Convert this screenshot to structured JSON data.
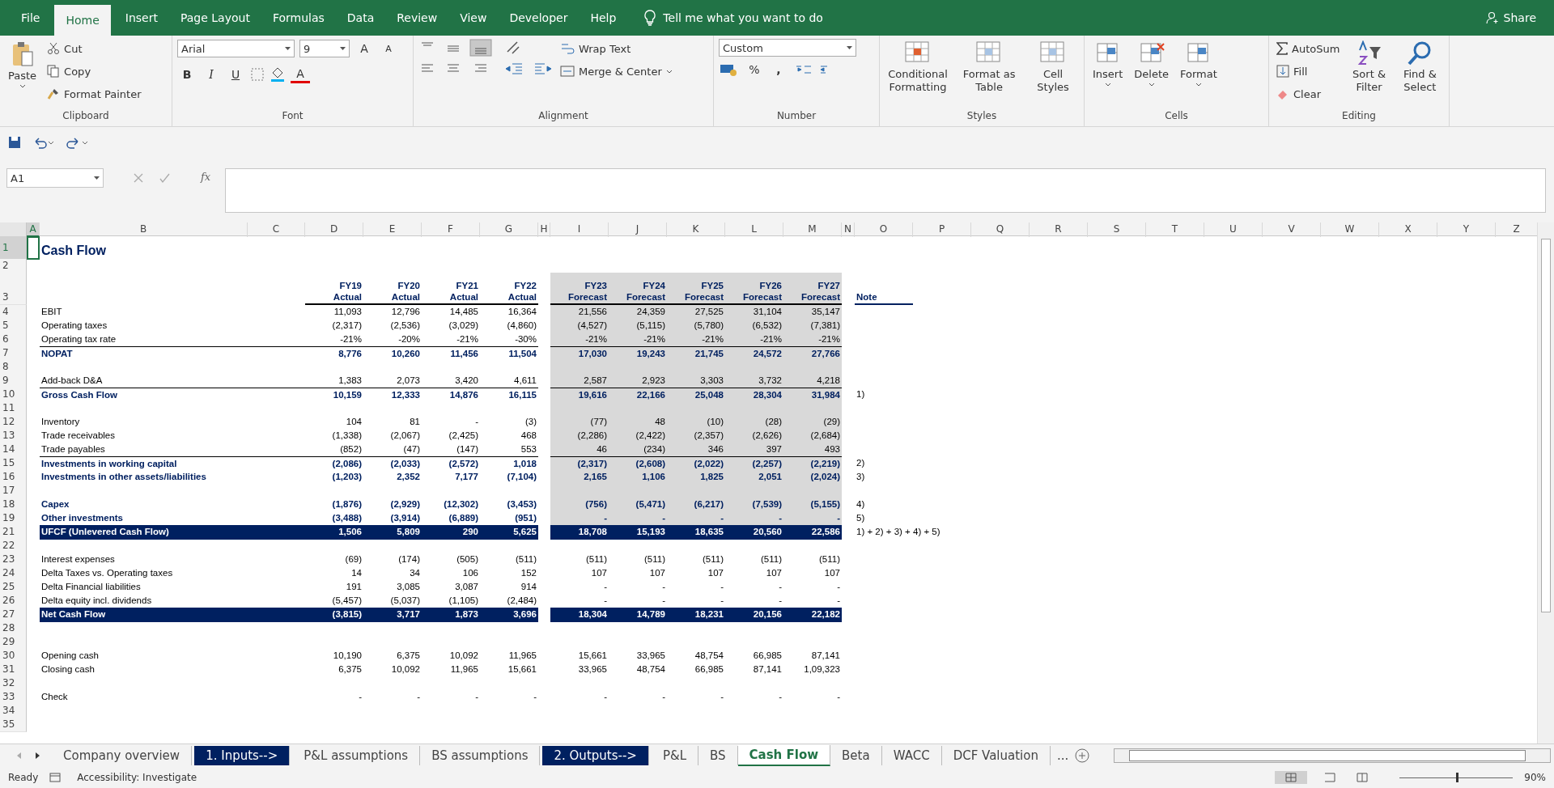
{
  "menu": {
    "tabs": [
      {
        "label": "File",
        "selected": false
      },
      {
        "label": "Home",
        "selected": true
      },
      {
        "label": "Insert",
        "selected": false
      },
      {
        "label": "Page Layout",
        "selected": false
      },
      {
        "label": "Formulas",
        "selected": false
      },
      {
        "label": "Data",
        "selected": false
      },
      {
        "label": "Review",
        "selected": false
      },
      {
        "label": "View",
        "selected": false
      },
      {
        "label": "Developer",
        "selected": false
      },
      {
        "label": "Help",
        "selected": false
      }
    ],
    "tell_me": "Tell me what you want to do",
    "share": "Share"
  },
  "ribbon": {
    "clipboard": {
      "paste": "Paste",
      "cut": "Cut",
      "copy": "Copy",
      "format_painter": "Format Painter",
      "label": "Clipboard"
    },
    "font": {
      "name": "Arial",
      "size": "9",
      "grow": "A",
      "shrink": "A",
      "bold": "B",
      "italic": "I",
      "underline": "U",
      "font_color": "A",
      "label": "Font"
    },
    "alignment": {
      "wrap": "Wrap Text",
      "merge": "Merge & Center",
      "label": "Alignment"
    },
    "number": {
      "format": "Custom",
      "percent": "%",
      "comma": ",",
      "label": "Number"
    },
    "styles": {
      "buttons": [
        "Conditional Formatting",
        "Format as Table",
        "Cell Styles"
      ],
      "label": "Styles"
    },
    "cells": {
      "buttons": [
        "Insert",
        "Delete",
        "Format"
      ],
      "label": "Cells"
    },
    "editing": {
      "autosum": "AutoSum",
      "fill": "Fill",
      "clear": "Clear",
      "sort": "Sort & Filter",
      "find": "Find & Select",
      "label": "Editing"
    }
  },
  "formula_bar": {
    "name_box": "A1",
    "fx": "fx"
  },
  "columns": [
    "A",
    "B",
    "C",
    "D",
    "E",
    "F",
    "G",
    "H",
    "I",
    "J",
    "K",
    "L",
    "M",
    "N",
    "O",
    "P",
    "Q",
    "R",
    "S",
    "T",
    "U",
    "V",
    "W",
    "X",
    "Y",
    "Z"
  ],
  "rows": [
    {
      "row": "1",
      "kind": "title",
      "label": "Cash Flow",
      "shaded": false
    },
    {
      "row": "2",
      "kind": "blank",
      "shaded": false
    },
    {
      "row": "3",
      "kind": "header",
      "shaded": true,
      "headers": [
        {
          "year": "FY19",
          "period": "Actual"
        },
        {
          "year": "FY20",
          "period": "Actual"
        },
        {
          "year": "FY21",
          "period": "Actual"
        },
        {
          "year": "FY22",
          "period": "Actual"
        },
        {
          "year": "FY23",
          "period": "Forecast"
        },
        {
          "year": "FY24",
          "period": "Forecast"
        },
        {
          "year": "FY25",
          "period": "Forecast"
        },
        {
          "year": "FY26",
          "period": "Forecast"
        },
        {
          "year": "FY27",
          "period": "Forecast"
        }
      ],
      "note": "Note"
    },
    {
      "row": "4",
      "kind": "line",
      "label": "EBIT",
      "shaded": true,
      "values": [
        "11,093",
        "12,796",
        "14,485",
        "16,364",
        "21,556",
        "24,359",
        "27,525",
        "31,104",
        "35,147"
      ]
    },
    {
      "row": "5",
      "kind": "line",
      "label": "Operating taxes",
      "shaded": true,
      "values": [
        "(2,317)",
        "(2,536)",
        "(3,029)",
        "(4,860)",
        "(4,527)",
        "(5,115)",
        "(5,780)",
        "(6,532)",
        "(7,381)"
      ]
    },
    {
      "row": "6",
      "kind": "line",
      "label": "Operating tax rate",
      "shaded": true,
      "values": [
        "-21%",
        "-20%",
        "-21%",
        "-30%",
        "-21%",
        "-21%",
        "-21%",
        "-21%",
        "-21%"
      ]
    },
    {
      "row": "7",
      "kind": "subtotal",
      "label": "NOPAT",
      "shaded": true,
      "values": [
        "8,776",
        "10,260",
        "11,456",
        "11,504",
        "17,030",
        "19,243",
        "21,745",
        "24,572",
        "27,766"
      ]
    },
    {
      "row": "8",
      "kind": "blank",
      "shaded": true
    },
    {
      "row": "9",
      "kind": "line",
      "label": "Add-back D&A",
      "shaded": true,
      "values": [
        "1,383",
        "2,073",
        "3,420",
        "4,611",
        "2,587",
        "2,923",
        "3,303",
        "3,732",
        "4,218"
      ]
    },
    {
      "row": "10",
      "kind": "subtotal",
      "label": "Gross Cash Flow",
      "shaded": true,
      "values": [
        "10,159",
        "12,333",
        "14,876",
        "16,115",
        "19,616",
        "22,166",
        "25,048",
        "28,304",
        "31,984"
      ],
      "note": "1)"
    },
    {
      "row": "11",
      "kind": "blank",
      "shaded": true
    },
    {
      "row": "12",
      "kind": "line",
      "label": "Inventory",
      "shaded": true,
      "values": [
        "104",
        "81",
        "-",
        "(3)",
        "(77)",
        "48",
        "(10)",
        "(28)",
        "(29)"
      ]
    },
    {
      "row": "13",
      "kind": "line",
      "label": "Trade receivables",
      "shaded": true,
      "values": [
        "(1,338)",
        "(2,067)",
        "(2,425)",
        "468",
        "(2,286)",
        "(2,422)",
        "(2,357)",
        "(2,626)",
        "(2,684)"
      ]
    },
    {
      "row": "14",
      "kind": "line",
      "label": "Trade payables",
      "shaded": true,
      "values": [
        "(852)",
        "(47)",
        "(147)",
        "553",
        "46",
        "(234)",
        "346",
        "397",
        "493"
      ]
    },
    {
      "row": "15",
      "kind": "subtotal",
      "label": "Investments in working capital",
      "shaded": true,
      "values": [
        "(2,086)",
        "(2,033)",
        "(2,572)",
        "1,018",
        "(2,317)",
        "(2,608)",
        "(2,022)",
        "(2,257)",
        "(2,219)"
      ],
      "note": "2)"
    },
    {
      "row": "16",
      "kind": "bold",
      "label": "Investments in other assets/liabilities",
      "shaded": true,
      "values": [
        "(1,203)",
        "2,352",
        "7,177",
        "(7,104)",
        "2,165",
        "1,106",
        "1,825",
        "2,051",
        "(2,024)"
      ],
      "note": "3)"
    },
    {
      "row": "17",
      "kind": "blank",
      "shaded": true
    },
    {
      "row": "18",
      "kind": "bold",
      "label": "Capex",
      "shaded": true,
      "values": [
        "(1,876)",
        "(2,929)",
        "(12,302)",
        "(3,453)",
        "(756)",
        "(5,471)",
        "(6,217)",
        "(7,539)",
        "(5,155)"
      ],
      "note": "4)"
    },
    {
      "row": "19",
      "kind": "bold",
      "label": "Other investments",
      "shaded": true,
      "values": [
        "(3,488)",
        "(3,914)",
        "(6,889)",
        "(951)",
        "-",
        "-",
        "-",
        "-",
        "-"
      ],
      "note": "5)"
    },
    {
      "row": "21",
      "kind": "total",
      "label": "UFCF (Unlevered Cash Flow)",
      "shaded": false,
      "values": [
        "1,506",
        "5,809",
        "290",
        "5,625",
        "18,708",
        "15,193",
        "18,635",
        "20,560",
        "22,586"
      ],
      "note": "1) + 2) + 3) + 4) + 5)"
    },
    {
      "row": "22",
      "kind": "blank",
      "shaded": false
    },
    {
      "row": "23",
      "kind": "line",
      "label": "Interest expenses",
      "shaded": false,
      "values": [
        "(69)",
        "(174)",
        "(505)",
        "(511)",
        "(511)",
        "(511)",
        "(511)",
        "(511)",
        "(511)"
      ]
    },
    {
      "row": "24",
      "kind": "line",
      "label": "Delta Taxes vs. Operating taxes",
      "shaded": false,
      "values": [
        "14",
        "34",
        "106",
        "152",
        "107",
        "107",
        "107",
        "107",
        "107"
      ]
    },
    {
      "row": "25",
      "kind": "line",
      "label": "Delta Financial liabilities",
      "shaded": false,
      "values": [
        "191",
        "3,085",
        "3,087",
        "914",
        "-",
        "-",
        "-",
        "-",
        "-"
      ]
    },
    {
      "row": "26",
      "kind": "line",
      "label": "Delta equity incl. dividends",
      "shaded": false,
      "values": [
        "(5,457)",
        "(5,037)",
        "(1,105)",
        "(2,484)",
        "-",
        "-",
        "-",
        "-",
        "-"
      ]
    },
    {
      "row": "27",
      "kind": "total",
      "label": "Net Cash Flow",
      "shaded": false,
      "values": [
        "(3,815)",
        "3,717",
        "1,873",
        "3,696",
        "18,304",
        "14,789",
        "18,231",
        "20,156",
        "22,182"
      ]
    },
    {
      "row": "28",
      "kind": "blank",
      "shaded": false
    },
    {
      "row": "29",
      "kind": "blank",
      "shaded": false
    },
    {
      "row": "30",
      "kind": "line",
      "label": "Opening cash",
      "shaded": false,
      "values": [
        "10,190",
        "6,375",
        "10,092",
        "11,965",
        "15,661",
        "33,965",
        "48,754",
        "66,985",
        "87,141"
      ]
    },
    {
      "row": "31",
      "kind": "line",
      "label": "Closing cash",
      "shaded": false,
      "values": [
        "6,375",
        "10,092",
        "11,965",
        "15,661",
        "33,965",
        "48,754",
        "66,985",
        "87,141",
        "1,09,323"
      ]
    },
    {
      "row": "32",
      "kind": "blank",
      "shaded": false
    },
    {
      "row": "33",
      "kind": "line",
      "label": "Check",
      "shaded": false,
      "values": [
        "-",
        "-",
        "-",
        "-",
        "-",
        "-",
        "-",
        "-",
        "-"
      ]
    },
    {
      "row": "34",
      "kind": "blank",
      "shaded": false
    },
    {
      "row": "35",
      "kind": "blank",
      "shaded": false
    }
  ],
  "sheet_tabs": [
    {
      "label": "Company overview",
      "kind": "sheet",
      "selected": false
    },
    {
      "label": "1. Inputs-->",
      "kind": "section",
      "selected": false
    },
    {
      "label": "P&L assumptions",
      "kind": "sheet",
      "selected": false
    },
    {
      "label": "BS assumptions",
      "kind": "sheet",
      "selected": false
    },
    {
      "label": "2. Outputs-->",
      "kind": "section",
      "selected": false
    },
    {
      "label": "P&L",
      "kind": "sheet",
      "selected": false
    },
    {
      "label": "BS",
      "kind": "sheet",
      "selected": false
    },
    {
      "label": "Cash Flow",
      "kind": "sheet",
      "selected": true
    },
    {
      "label": "Beta",
      "kind": "sheet",
      "selected": false
    },
    {
      "label": "WACC",
      "kind": "sheet",
      "selected": false
    },
    {
      "label": "DCF Valuation",
      "kind": "sheet",
      "selected": false
    }
  ],
  "more_tabs": "...",
  "status_bar": {
    "ready": "Ready",
    "accessibility": "Accessibility: Investigate",
    "zoom": "90%",
    "level": 0.5
  }
}
